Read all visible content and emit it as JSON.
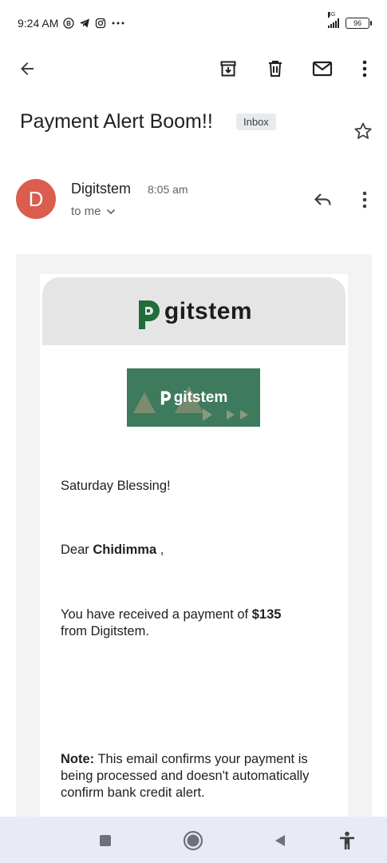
{
  "status_bar": {
    "time": "9:24 AM",
    "icons": [
      "b-badge-icon",
      "telegram-icon",
      "instagram-icon",
      "more-dots-icon"
    ],
    "network": "4G",
    "battery": "96"
  },
  "toolbar": {
    "icons": [
      "back-arrow-icon",
      "archive-icon",
      "delete-icon",
      "mark-unread-icon",
      "more-vert-icon"
    ]
  },
  "email": {
    "subject": "Payment Alert Boom!!",
    "label": "Inbox",
    "sender": "Digitstem",
    "avatar_letter": "D",
    "time": "8:05 am",
    "recipient": "to me",
    "avatar_color": "#db5d4e"
  },
  "body": {
    "header_logo": "gitstem",
    "banner_logo": "gitstem",
    "greeting": "Saturday Blessing!",
    "dear_prefix": "Dear ",
    "dear_name": "Chidimma",
    "dear_suffix": " ,",
    "payment_prefix": "You have received a payment of ",
    "payment_amount": "$135",
    "payment_suffix": "from Digitstem.",
    "note_label": "Note:",
    "note_text": " This email confirms your payment is being processed and doesn't automatically confirm bank credit alert.",
    "brand_color": "#1e6e3a",
    "banner_color": "#3d7a5e"
  },
  "nav_bar": {
    "icons": [
      "recents-square-icon",
      "home-circle-icon",
      "back-triangle-icon",
      "accessibility-icon"
    ]
  }
}
